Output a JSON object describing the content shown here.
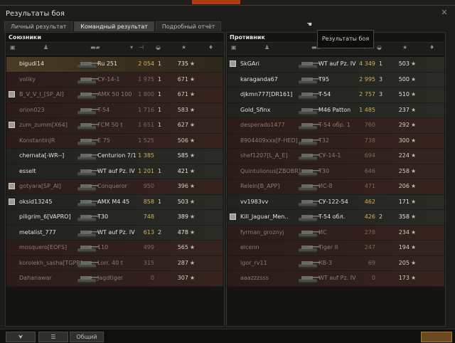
{
  "window": {
    "title": "Результаты боя",
    "close": "✕"
  },
  "tabs": [
    {
      "label": "Личный результат",
      "active": false
    },
    {
      "label": "Командный результат",
      "active": true
    },
    {
      "label": "Подробный отчёт",
      "active": false
    }
  ],
  "tooltip": "Результаты боя",
  "bottom": {
    "chat_label": "Общий"
  },
  "allies": {
    "title": "Союзники",
    "rows": [
      {
        "name": "bigudi14",
        "tank": "Ru 251",
        "damage": "2 054",
        "kills": "1",
        "exp": "735",
        "platoon": false,
        "state": "self"
      },
      {
        "name": "voliky",
        "tank": "СУ-14-1",
        "damage": "1 975",
        "kills": "1",
        "exp": "671",
        "platoon": false,
        "state": "dead"
      },
      {
        "name": "B_V_V_I_[SP_AI]",
        "tank": "AMX 50 100",
        "damage": "1 800",
        "kills": "1",
        "exp": "671",
        "platoon": true,
        "state": "dead"
      },
      {
        "name": "orion023",
        "tank": "T-54",
        "damage": "1 716",
        "kills": "1",
        "exp": "583",
        "platoon": false,
        "state": "dead"
      },
      {
        "name": "zum_zumm[X64]",
        "tank": "FCM 50 t",
        "damage": "1 651",
        "kills": "1",
        "exp": "627",
        "platoon": true,
        "state": "dead"
      },
      {
        "name": "KonstantinJR",
        "tank": "E 75",
        "damage": "1 525",
        "kills": "",
        "exp": "506",
        "platoon": false,
        "state": "dead"
      },
      {
        "name": "chernata[-WR--]",
        "tank": "Centurion 7/1",
        "damage": "1 385",
        "kills": "",
        "exp": "585",
        "platoon": false,
        "state": "alive"
      },
      {
        "name": "esselt",
        "tank": "WT auf Pz. IV",
        "damage": "1 201",
        "kills": "1",
        "exp": "421",
        "platoon": false,
        "state": "alive"
      },
      {
        "name": "gotyara[SP_AI]",
        "tank": "Conqueror",
        "damage": "950",
        "kills": "",
        "exp": "396",
        "platoon": true,
        "state": "dead"
      },
      {
        "name": "oksid13245",
        "tank": "AMX M4 45",
        "damage": "858",
        "kills": "1",
        "exp": "503",
        "platoon": true,
        "state": "alive"
      },
      {
        "name": "piligrim_6[VAPRO]",
        "tank": "T30",
        "damage": "748",
        "kills": "",
        "exp": "389",
        "platoon": false,
        "state": "alive"
      },
      {
        "name": "metalist_777",
        "tank": "WT auf Pz. IV",
        "damage": "613",
        "kills": "2",
        "exp": "478",
        "platoon": false,
        "state": "alive"
      },
      {
        "name": "mosquero[EOFS]",
        "tank": "110",
        "damage": "499",
        "kills": "",
        "exp": "565",
        "platoon": false,
        "state": "dead"
      },
      {
        "name": "korolekh_sasha[TGPR]",
        "tank": "Lorr. 40 t",
        "damage": "315",
        "kills": "",
        "exp": "287",
        "platoon": false,
        "state": "dead"
      },
      {
        "name": "Dahanawar",
        "tank": "Jagdtiger",
        "damage": "0",
        "kills": "",
        "exp": "307",
        "platoon": false,
        "state": "dead"
      }
    ]
  },
  "enemies": {
    "title": "Противник",
    "rows": [
      {
        "name": "SkGAri",
        "tank": "WT auf Pz. IV",
        "damage": "4 349",
        "kills": "1",
        "exp": "503",
        "platoon": true,
        "state": "alive"
      },
      {
        "name": "karaganda67",
        "tank": "T95",
        "damage": "2 995",
        "kills": "3",
        "exp": "500",
        "platoon": false,
        "state": "alive"
      },
      {
        "name": "djkmn777[DR161]",
        "tank": "T-54",
        "damage": "2 757",
        "kills": "3",
        "exp": "510",
        "platoon": false,
        "state": "alive"
      },
      {
        "name": "Gold_Sfinx",
        "tank": "M46 Patton",
        "damage": "1 485",
        "kills": "",
        "exp": "237",
        "platoon": false,
        "state": "alive"
      },
      {
        "name": "desperado1477",
        "tank": "T-54 обр. 1",
        "damage": "760",
        "kills": "",
        "exp": "292",
        "platoon": false,
        "state": "dead"
      },
      {
        "name": "8904409xxx[F-HED]",
        "tank": "T32",
        "damage": "738",
        "kills": "",
        "exp": "300",
        "platoon": false,
        "state": "dead"
      },
      {
        "name": "shef1207[L_A_E]",
        "tank": "СУ-14-1",
        "damage": "694",
        "kills": "",
        "exp": "224",
        "platoon": false,
        "state": "dead"
      },
      {
        "name": "Quintulionus[ZBOBR]",
        "tank": "T30",
        "damage": "646",
        "kills": "",
        "exp": "258",
        "platoon": false,
        "state": "dead"
      },
      {
        "name": "Relein[B_APP]",
        "tank": "ИС-8",
        "damage": "471",
        "kills": "",
        "exp": "206",
        "platoon": false,
        "state": "dead"
      },
      {
        "name": "vv1983vv",
        "tank": "СУ-122-54",
        "damage": "462",
        "kills": "",
        "exp": "171",
        "platoon": false,
        "state": "alive"
      },
      {
        "name": "Kill_Jaguar_Men..",
        "tank": "T-54 обл.",
        "damage": "426",
        "kills": "2",
        "exp": "358",
        "platoon": true,
        "state": "alive"
      },
      {
        "name": "fyrman_groznyj",
        "tank": "ИС",
        "damage": "278",
        "kills": "",
        "exp": "234",
        "platoon": false,
        "state": "dead"
      },
      {
        "name": "elcenn",
        "tank": "Tiger II",
        "damage": "247",
        "kills": "",
        "exp": "194",
        "platoon": false,
        "state": "dead"
      },
      {
        "name": "lgor_rv11",
        "tank": "КВ-3",
        "damage": "69",
        "kills": "",
        "exp": "205",
        "platoon": false,
        "state": "dead"
      },
      {
        "name": "aaazzzsss",
        "tank": "WT auf Pz. IV",
        "damage": "0",
        "kills": "",
        "exp": "173",
        "platoon": false,
        "state": "dead"
      }
    ]
  },
  "icons": {
    "star": "★",
    "header": [
      "platoon-icon",
      "player-icon",
      "tank-icon",
      "sort-icon",
      "damage-icon",
      "kills-icon",
      "experience-icon",
      "medal-icon"
    ]
  }
}
